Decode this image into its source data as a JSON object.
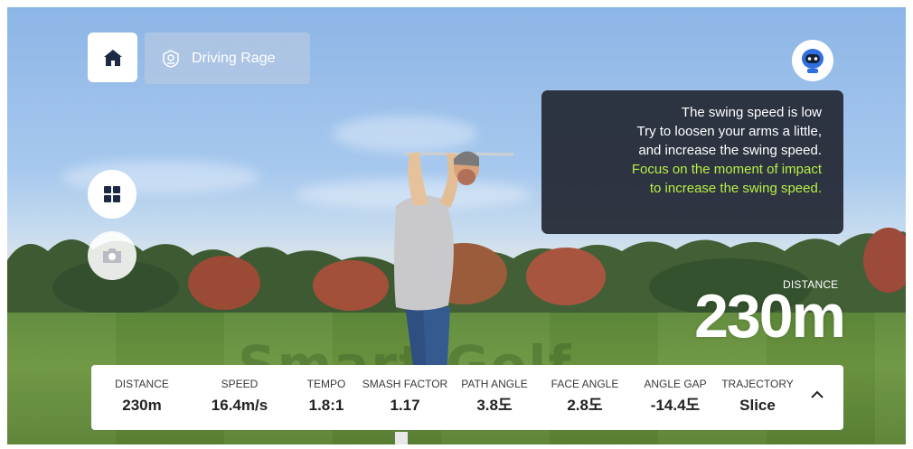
{
  "header": {
    "course_label": "Driving Rage"
  },
  "icons": {
    "home": "home-icon",
    "course": "course-emblem-icon",
    "grid": "grid-icon",
    "camera": "camera-icon",
    "coach": "robot-coach-icon",
    "expand": "chevron-up-icon"
  },
  "tip": {
    "line1": "The swing speed is low",
    "line2": "Try to loosen your arms a little,",
    "line3": "and increase the swing speed.",
    "highlight1": "Focus on the moment of impact",
    "highlight2": "to increase the swing speed."
  },
  "distance_display": {
    "caption": "DISTANCE",
    "value": "230m"
  },
  "watermark": "Smart Golf",
  "stats": [
    {
      "label": "DISTANCE",
      "value": "230m"
    },
    {
      "label": "SPEED",
      "value": "16.4m/s"
    },
    {
      "label": "TEMPO",
      "value": "1.8:1"
    },
    {
      "label": "SMASH FACTOR",
      "value": "1.17"
    },
    {
      "label": "PATH ANGLE",
      "value": "3.8도"
    },
    {
      "label": "FACE ANGLE",
      "value": "2.8도"
    },
    {
      "label": "ANGLE GAP",
      "value": "-14.4도"
    },
    {
      "label": "TRAJECTORY",
      "value": "Slice"
    }
  ],
  "colors": {
    "tip_background": "#242834",
    "tip_highlight": "#b6ef45",
    "stats_background": "#ffffff"
  }
}
